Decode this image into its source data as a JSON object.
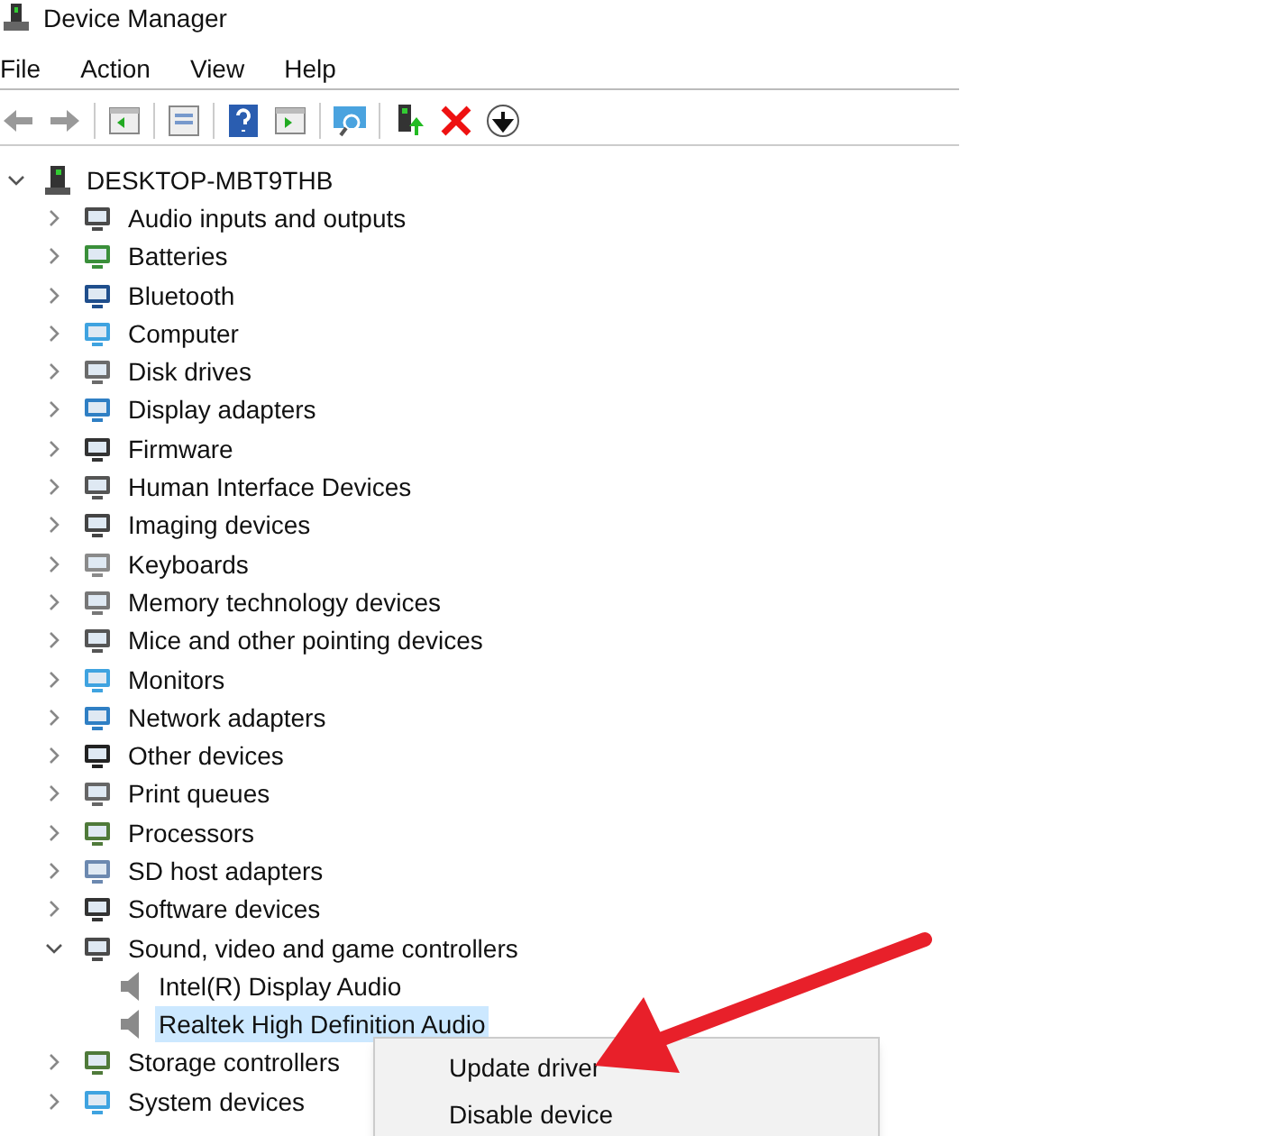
{
  "window": {
    "title": "Device Manager"
  },
  "menu": [
    "File",
    "Action",
    "View",
    "Help"
  ],
  "tree": {
    "label": "DESKTOP-MBT9THB",
    "expanded": true,
    "selected": false,
    "children": [
      {
        "label": "Audio inputs and outputs",
        "expanded": false,
        "selected": false
      },
      {
        "label": "Batteries",
        "expanded": false,
        "selected": false
      },
      {
        "label": "Bluetooth",
        "expanded": false,
        "selected": false
      },
      {
        "label": "Computer",
        "expanded": false,
        "selected": false
      },
      {
        "label": "Disk drives",
        "expanded": false,
        "selected": false
      },
      {
        "label": "Display adapters",
        "expanded": false,
        "selected": false
      },
      {
        "label": "Firmware",
        "expanded": false,
        "selected": false
      },
      {
        "label": "Human Interface Devices",
        "expanded": false,
        "selected": false
      },
      {
        "label": "Imaging devices",
        "expanded": false,
        "selected": false
      },
      {
        "label": "Keyboards",
        "expanded": false,
        "selected": false
      },
      {
        "label": "Memory technology devices",
        "expanded": false,
        "selected": false
      },
      {
        "label": "Mice and other pointing devices",
        "expanded": false,
        "selected": false
      },
      {
        "label": "Monitors",
        "expanded": false,
        "selected": false
      },
      {
        "label": "Network adapters",
        "expanded": false,
        "selected": false
      },
      {
        "label": "Other devices",
        "expanded": false,
        "selected": false
      },
      {
        "label": "Print queues",
        "expanded": false,
        "selected": false
      },
      {
        "label": "Processors",
        "expanded": false,
        "selected": false
      },
      {
        "label": "SD host adapters",
        "expanded": false,
        "selected": false
      },
      {
        "label": "Software devices",
        "expanded": false,
        "selected": false
      },
      {
        "label": "Sound, video and game controllers",
        "expanded": true,
        "selected": false,
        "children": [
          {
            "label": "Intel(R) Display Audio",
            "selected": false
          },
          {
            "label": "Realtek High Definition Audio",
            "selected": true
          }
        ]
      },
      {
        "label": "Storage controllers",
        "expanded": false,
        "selected": false
      },
      {
        "label": "System devices",
        "expanded": false,
        "selected": false
      }
    ]
  },
  "context_menu": [
    "Update driver",
    "Disable device"
  ]
}
